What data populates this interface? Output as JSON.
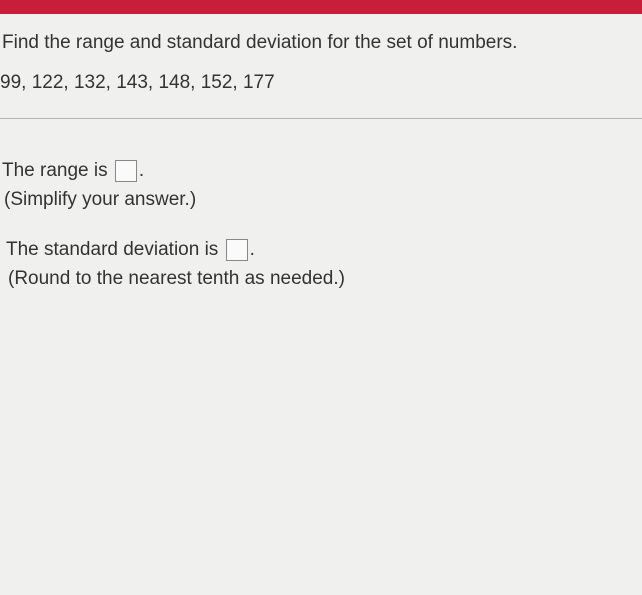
{
  "question": {
    "prompt": "Find the range and standard deviation for the set of numbers.",
    "data": "99, 122, 132, 143, 148, 152, 177"
  },
  "answers": {
    "range": {
      "label_pre": "The range is ",
      "label_post": ".",
      "hint": "(Simplify your answer.)",
      "value": ""
    },
    "stddev": {
      "label_pre": "The standard deviation is ",
      "label_post": ".",
      "hint": "(Round to the nearest tenth as needed.)",
      "value": ""
    }
  }
}
